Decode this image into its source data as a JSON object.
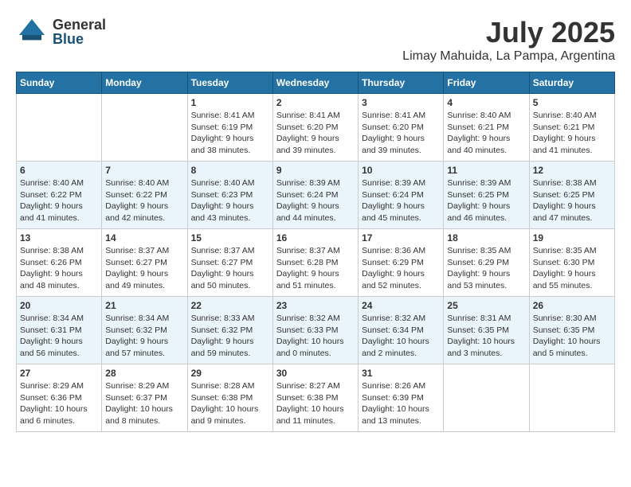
{
  "logo": {
    "general": "General",
    "blue": "Blue"
  },
  "title": "July 2025",
  "location": "Limay Mahuida, La Pampa, Argentina",
  "days_of_week": [
    "Sunday",
    "Monday",
    "Tuesday",
    "Wednesday",
    "Thursday",
    "Friday",
    "Saturday"
  ],
  "weeks": [
    [
      {
        "day": "",
        "sunrise": "",
        "sunset": "",
        "daylight": ""
      },
      {
        "day": "",
        "sunrise": "",
        "sunset": "",
        "daylight": ""
      },
      {
        "day": "1",
        "sunrise": "Sunrise: 8:41 AM",
        "sunset": "Sunset: 6:19 PM",
        "daylight": "Daylight: 9 hours and 38 minutes."
      },
      {
        "day": "2",
        "sunrise": "Sunrise: 8:41 AM",
        "sunset": "Sunset: 6:20 PM",
        "daylight": "Daylight: 9 hours and 39 minutes."
      },
      {
        "day": "3",
        "sunrise": "Sunrise: 8:41 AM",
        "sunset": "Sunset: 6:20 PM",
        "daylight": "Daylight: 9 hours and 39 minutes."
      },
      {
        "day": "4",
        "sunrise": "Sunrise: 8:40 AM",
        "sunset": "Sunset: 6:21 PM",
        "daylight": "Daylight: 9 hours and 40 minutes."
      },
      {
        "day": "5",
        "sunrise": "Sunrise: 8:40 AM",
        "sunset": "Sunset: 6:21 PM",
        "daylight": "Daylight: 9 hours and 41 minutes."
      }
    ],
    [
      {
        "day": "6",
        "sunrise": "Sunrise: 8:40 AM",
        "sunset": "Sunset: 6:22 PM",
        "daylight": "Daylight: 9 hours and 41 minutes."
      },
      {
        "day": "7",
        "sunrise": "Sunrise: 8:40 AM",
        "sunset": "Sunset: 6:22 PM",
        "daylight": "Daylight: 9 hours and 42 minutes."
      },
      {
        "day": "8",
        "sunrise": "Sunrise: 8:40 AM",
        "sunset": "Sunset: 6:23 PM",
        "daylight": "Daylight: 9 hours and 43 minutes."
      },
      {
        "day": "9",
        "sunrise": "Sunrise: 8:39 AM",
        "sunset": "Sunset: 6:24 PM",
        "daylight": "Daylight: 9 hours and 44 minutes."
      },
      {
        "day": "10",
        "sunrise": "Sunrise: 8:39 AM",
        "sunset": "Sunset: 6:24 PM",
        "daylight": "Daylight: 9 hours and 45 minutes."
      },
      {
        "day": "11",
        "sunrise": "Sunrise: 8:39 AM",
        "sunset": "Sunset: 6:25 PM",
        "daylight": "Daylight: 9 hours and 46 minutes."
      },
      {
        "day": "12",
        "sunrise": "Sunrise: 8:38 AM",
        "sunset": "Sunset: 6:25 PM",
        "daylight": "Daylight: 9 hours and 47 minutes."
      }
    ],
    [
      {
        "day": "13",
        "sunrise": "Sunrise: 8:38 AM",
        "sunset": "Sunset: 6:26 PM",
        "daylight": "Daylight: 9 hours and 48 minutes."
      },
      {
        "day": "14",
        "sunrise": "Sunrise: 8:37 AM",
        "sunset": "Sunset: 6:27 PM",
        "daylight": "Daylight: 9 hours and 49 minutes."
      },
      {
        "day": "15",
        "sunrise": "Sunrise: 8:37 AM",
        "sunset": "Sunset: 6:27 PM",
        "daylight": "Daylight: 9 hours and 50 minutes."
      },
      {
        "day": "16",
        "sunrise": "Sunrise: 8:37 AM",
        "sunset": "Sunset: 6:28 PM",
        "daylight": "Daylight: 9 hours and 51 minutes."
      },
      {
        "day": "17",
        "sunrise": "Sunrise: 8:36 AM",
        "sunset": "Sunset: 6:29 PM",
        "daylight": "Daylight: 9 hours and 52 minutes."
      },
      {
        "day": "18",
        "sunrise": "Sunrise: 8:35 AM",
        "sunset": "Sunset: 6:29 PM",
        "daylight": "Daylight: 9 hours and 53 minutes."
      },
      {
        "day": "19",
        "sunrise": "Sunrise: 8:35 AM",
        "sunset": "Sunset: 6:30 PM",
        "daylight": "Daylight: 9 hours and 55 minutes."
      }
    ],
    [
      {
        "day": "20",
        "sunrise": "Sunrise: 8:34 AM",
        "sunset": "Sunset: 6:31 PM",
        "daylight": "Daylight: 9 hours and 56 minutes."
      },
      {
        "day": "21",
        "sunrise": "Sunrise: 8:34 AM",
        "sunset": "Sunset: 6:32 PM",
        "daylight": "Daylight: 9 hours and 57 minutes."
      },
      {
        "day": "22",
        "sunrise": "Sunrise: 8:33 AM",
        "sunset": "Sunset: 6:32 PM",
        "daylight": "Daylight: 9 hours and 59 minutes."
      },
      {
        "day": "23",
        "sunrise": "Sunrise: 8:32 AM",
        "sunset": "Sunset: 6:33 PM",
        "daylight": "Daylight: 10 hours and 0 minutes."
      },
      {
        "day": "24",
        "sunrise": "Sunrise: 8:32 AM",
        "sunset": "Sunset: 6:34 PM",
        "daylight": "Daylight: 10 hours and 2 minutes."
      },
      {
        "day": "25",
        "sunrise": "Sunrise: 8:31 AM",
        "sunset": "Sunset: 6:35 PM",
        "daylight": "Daylight: 10 hours and 3 minutes."
      },
      {
        "day": "26",
        "sunrise": "Sunrise: 8:30 AM",
        "sunset": "Sunset: 6:35 PM",
        "daylight": "Daylight: 10 hours and 5 minutes."
      }
    ],
    [
      {
        "day": "27",
        "sunrise": "Sunrise: 8:29 AM",
        "sunset": "Sunset: 6:36 PM",
        "daylight": "Daylight: 10 hours and 6 minutes."
      },
      {
        "day": "28",
        "sunrise": "Sunrise: 8:29 AM",
        "sunset": "Sunset: 6:37 PM",
        "daylight": "Daylight: 10 hours and 8 minutes."
      },
      {
        "day": "29",
        "sunrise": "Sunrise: 8:28 AM",
        "sunset": "Sunset: 6:38 PM",
        "daylight": "Daylight: 10 hours and 9 minutes."
      },
      {
        "day": "30",
        "sunrise": "Sunrise: 8:27 AM",
        "sunset": "Sunset: 6:38 PM",
        "daylight": "Daylight: 10 hours and 11 minutes."
      },
      {
        "day": "31",
        "sunrise": "Sunrise: 8:26 AM",
        "sunset": "Sunset: 6:39 PM",
        "daylight": "Daylight: 10 hours and 13 minutes."
      },
      {
        "day": "",
        "sunrise": "",
        "sunset": "",
        "daylight": ""
      },
      {
        "day": "",
        "sunrise": "",
        "sunset": "",
        "daylight": ""
      }
    ]
  ]
}
